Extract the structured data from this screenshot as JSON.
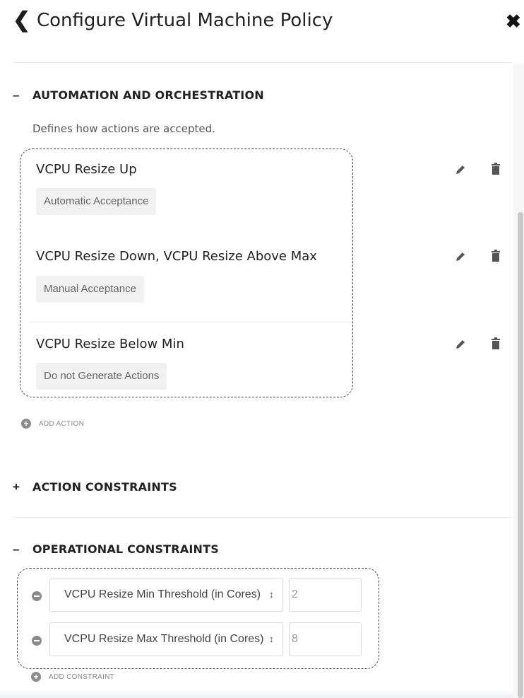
{
  "header": {
    "title": "Configure Virtual Machine Policy",
    "back_icon": "chevron-left-icon",
    "close_icon": "close-icon"
  },
  "automation": {
    "toggle": "–",
    "title": "AUTOMATION AND ORCHESTRATION",
    "description": "Defines how actions are accepted.",
    "actions": [
      {
        "title": "VCPU Resize Up",
        "mode": "Automatic Acceptance"
      },
      {
        "title": "VCPU Resize Down, VCPU Resize Above Max",
        "mode": "Manual Acceptance"
      },
      {
        "title": "VCPU Resize Below Min",
        "mode": "Do not Generate Actions"
      }
    ],
    "add_action": "ADD ACTION",
    "edit_icon": "pencil-icon",
    "delete_icon": "trash-icon"
  },
  "action_constraints": {
    "toggle": "+",
    "title": "ACTION CONSTRAINTS"
  },
  "operational": {
    "toggle": "–",
    "title": "OPERATIONAL CONSTRAINTS",
    "constraints": [
      {
        "select": "VCPU Resize Min Threshold (in Cores)",
        "value": "2"
      },
      {
        "select": "VCPU Resize Max Threshold (in Cores)",
        "value": "8"
      }
    ],
    "add_constraint": "ADD CONSTRAINT"
  },
  "colors": {
    "dashed_border": "#3a4a5e",
    "badge_bg": "#f1f1f1",
    "icon_gray": "#8a8a8a"
  }
}
